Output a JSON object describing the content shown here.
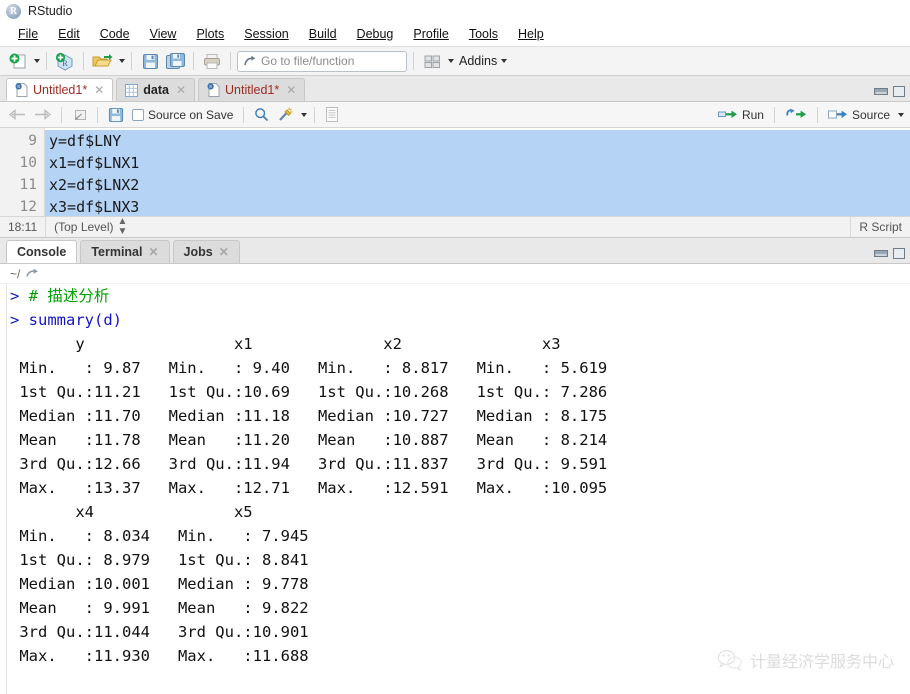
{
  "window": {
    "title": "RStudio",
    "logo_letter": "R"
  },
  "menubar": {
    "items": [
      {
        "label": "File",
        "accel": "F"
      },
      {
        "label": "Edit",
        "accel": "E"
      },
      {
        "label": "Code",
        "accel": "C"
      },
      {
        "label": "View",
        "accel": "V"
      },
      {
        "label": "Plots",
        "accel": "P"
      },
      {
        "label": "Session",
        "accel": "S"
      },
      {
        "label": "Build",
        "accel": "B"
      },
      {
        "label": "Debug",
        "accel": "D"
      },
      {
        "label": "Profile",
        "accel": "P"
      },
      {
        "label": "Tools",
        "accel": "T"
      },
      {
        "label": "Help",
        "accel": "H"
      }
    ]
  },
  "toolbar": {
    "new_file_icon": "new-file-icon",
    "new_project_icon": "new-project-icon",
    "open_file_icon": "open-folder-icon",
    "save_icon": "save-icon",
    "save_all_icon": "save-all-icon",
    "print_icon": "print-icon",
    "goto_placeholder": "Go to file/function",
    "goto_value": "",
    "workspace_panes_icon": "workspace-panes-icon",
    "addins_label": "Addins"
  },
  "source_pane": {
    "tabs": [
      {
        "label": "Untitled1*",
        "icon": "r-script-icon",
        "active": true,
        "closable": true
      },
      {
        "label": "data",
        "icon": "data-grid-icon",
        "active": false,
        "closable": true
      },
      {
        "label": "Untitled1*",
        "icon": "r-script-icon",
        "active": false,
        "closable": true
      }
    ],
    "toolbar": {
      "back_icon": "back-arrow-icon",
      "forward_icon": "forward-arrow-icon",
      "popout_icon": "show-in-new-window-icon",
      "save_icon": "save-icon",
      "source_on_save_label": "Source on Save",
      "source_on_save_checked": false,
      "find_icon": "search-icon",
      "magic_icon": "code-tools-icon",
      "compile_report_icon": "compile-report-icon",
      "run_label": "Run",
      "rerun_icon": "re-run-icon",
      "source_label": "Source"
    },
    "code_lines": [
      {
        "number": "9",
        "text": "y=df$LNY",
        "selected": true
      },
      {
        "number": "10",
        "text": "x1=df$LNX1",
        "selected": true
      },
      {
        "number": "11",
        "text": "x2=df$LNX2",
        "selected": true
      },
      {
        "number": "12",
        "text": "x3=df$LNX3",
        "selected": true
      }
    ],
    "status": {
      "cursor_position": "18:11",
      "scope": "(Top Level)",
      "file_type": "R Script"
    }
  },
  "console_pane": {
    "tabs": [
      {
        "label": "Console",
        "active": true,
        "closable": false
      },
      {
        "label": "Terminal",
        "active": false,
        "closable": true
      },
      {
        "label": "Jobs",
        "active": false,
        "closable": true
      }
    ],
    "working_directory": "~/",
    "lines": [
      {
        "kind": "prompt-comment",
        "prompt": "> ",
        "text": "# 描述分析"
      },
      {
        "kind": "prompt-code",
        "prompt": "> ",
        "text": "summary(d)"
      },
      {
        "kind": "output",
        "text": "       y                x1              x2               x3        "
      },
      {
        "kind": "output",
        "text": " Min.   : 9.87   Min.   : 9.40   Min.   : 8.817   Min.   : 5.619  "
      },
      {
        "kind": "output",
        "text": " 1st Qu.:11.21   1st Qu.:10.69   1st Qu.:10.268   1st Qu.: 7.286  "
      },
      {
        "kind": "output",
        "text": " Median :11.70   Median :11.18   Median :10.727   Median : 8.175  "
      },
      {
        "kind": "output",
        "text": " Mean   :11.78   Mean   :11.20   Mean   :10.887   Mean   : 8.214  "
      },
      {
        "kind": "output",
        "text": " 3rd Qu.:12.66   3rd Qu.:11.94   3rd Qu.:11.837   3rd Qu.: 9.591  "
      },
      {
        "kind": "output",
        "text": " Max.   :13.37   Max.   :12.71   Max.   :12.591   Max.   :10.095  "
      },
      {
        "kind": "output",
        "text": "       x4               x5        "
      },
      {
        "kind": "output",
        "text": " Min.   : 8.034   Min.   : 7.945  "
      },
      {
        "kind": "output",
        "text": " 1st Qu.: 8.979   1st Qu.: 8.841  "
      },
      {
        "kind": "output",
        "text": " Median :10.001   Median : 9.778  "
      },
      {
        "kind": "output",
        "text": " Mean   : 9.991   Mean   : 9.822  "
      },
      {
        "kind": "output",
        "text": " 3rd Qu.:11.044   3rd Qu.:10.901  "
      },
      {
        "kind": "output",
        "text": " Max.   :11.930   Max.   :11.688  "
      }
    ],
    "summary_table": {
      "statistics": [
        "Min.",
        "1st Qu.",
        "Median",
        "Mean",
        "3rd Qu.",
        "Max."
      ],
      "columns": [
        {
          "name": "y",
          "values": [
            "9.87",
            "11.21",
            "11.70",
            "11.78",
            "12.66",
            "13.37"
          ]
        },
        {
          "name": "x1",
          "values": [
            "9.40",
            "10.69",
            "11.18",
            "11.20",
            "11.94",
            "12.71"
          ]
        },
        {
          "name": "x2",
          "values": [
            "8.817",
            "10.268",
            "10.727",
            "10.887",
            "11.837",
            "12.591"
          ]
        },
        {
          "name": "x3",
          "values": [
            "5.619",
            "7.286",
            "8.175",
            "8.214",
            "9.591",
            "10.095"
          ]
        },
        {
          "name": "x4",
          "values": [
            "8.034",
            "8.979",
            "10.001",
            "9.991",
            "11.044",
            "11.930"
          ]
        },
        {
          "name": "x5",
          "values": [
            "7.945",
            "8.841",
            "9.778",
            "9.822",
            "10.901",
            "11.688"
          ]
        }
      ]
    }
  },
  "watermark": {
    "text": "计量经济学服务中心",
    "logo": "wechat-logo"
  },
  "colors": {
    "selection": "#b4d3f5",
    "prompt_blue": "#1414c8",
    "comment_green": "#00a000",
    "tab_active_text": "#9e2b1f"
  }
}
